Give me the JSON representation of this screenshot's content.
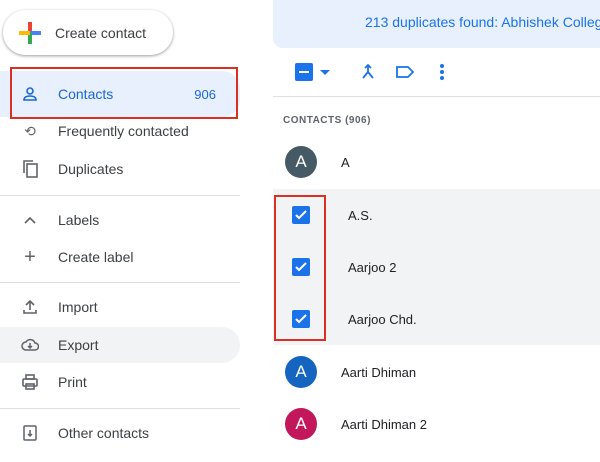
{
  "create_contact": "Create contact",
  "sidebar": {
    "contacts": {
      "label": "Contacts",
      "count": "906"
    },
    "items": [
      {
        "label": "Frequently contacted"
      },
      {
        "label": "Duplicates"
      },
      {
        "label": "Labels"
      },
      {
        "label": "Create label"
      },
      {
        "label": "Import"
      },
      {
        "label": "Export"
      },
      {
        "label": "Print"
      },
      {
        "label": "Other contacts"
      }
    ]
  },
  "banner": "213 duplicates found: Abhishek Colleg,",
  "list_header": "CONTACTS (906)",
  "contacts": [
    {
      "name": "A",
      "initial": "A",
      "color": "#455a64",
      "selected": false
    },
    {
      "name": "A.S.",
      "selected": true
    },
    {
      "name": "Aarjoo 2",
      "selected": true
    },
    {
      "name": "Aarjoo Chd.",
      "selected": true
    },
    {
      "name": "Aarti Dhiman",
      "initial": "A",
      "color": "#1565c0",
      "selected": false
    },
    {
      "name": "Aarti Dhiman 2",
      "initial": "A",
      "color": "#c2185b",
      "selected": false
    }
  ],
  "colors": {
    "accent": "#1a73e8",
    "highlight": "#d93025"
  }
}
